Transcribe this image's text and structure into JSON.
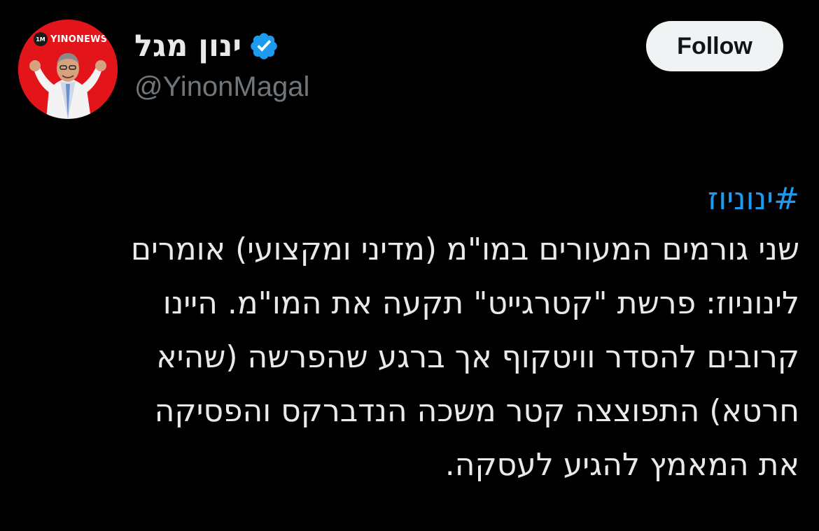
{
  "author": {
    "display_name": "ינון מגל",
    "handle": "@YinonMagal",
    "verified": true,
    "avatar_logo_badge": "1M",
    "avatar_logo_text": "YINONEWS",
    "avatar_bg_color": "#e4141b"
  },
  "follow_button": {
    "label": "Follow"
  },
  "tweet": {
    "hashtag": "#ינוניוז",
    "lines": [
      "שני גורמים המעורים במו\"מ (מדיני ומקצועי) אומרים",
      "לינוניוז: פרשת \"קטרגייט\" תקעה את המו\"מ. היינו",
      "קרובים להסדר וויטקוף אך ברגע שהפרשה (שהיא",
      "חרטא) התפוצצה קטר משכה הנדברקס והפסיקה",
      "את המאמץ להגיע לעסקה."
    ]
  },
  "colors": {
    "background": "#000000",
    "text_primary": "#e7e9ea",
    "text_secondary": "#71767b",
    "link": "#1d9bf0",
    "verified_badge": "#1d9bf0",
    "follow_button_bg": "#eff3f4"
  }
}
